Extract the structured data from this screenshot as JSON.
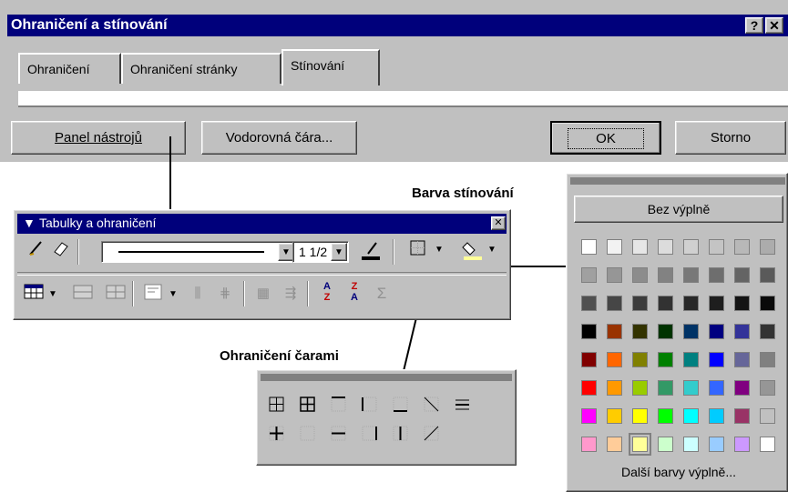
{
  "dialog": {
    "title": "Ohraničení a stínování",
    "title_buttons": [
      "?",
      "✕"
    ],
    "tabs": [
      {
        "label": "Ohraničení",
        "active": false
      },
      {
        "label": "Ohraničení stránky",
        "active": false
      },
      {
        "label": "Stínování",
        "active": true
      }
    ],
    "buttons": {
      "toolbar": "Panel nástrojů",
      "horizontal_line": "Vodorovná čára...",
      "ok": "OK",
      "cancel": "Storno"
    }
  },
  "toolbar": {
    "title": "Tabulky a ohraničení",
    "close": "✕",
    "line_weight": "1 1/2",
    "row1_icons": [
      "pencil-icon",
      "eraser-icon",
      "line-style-dropdown",
      "line-weight-dropdown",
      "border-color-icon",
      "outside-border-icon",
      "shading-color-icon"
    ],
    "row2_icons": [
      "insert-table-icon",
      "merge-cells-icon",
      "split-cells-icon",
      "align-icon",
      "distribute-rows-icon",
      "distribute-columns-icon",
      "autoformat-icon",
      "text-direction-icon",
      "sort-ascending-icon",
      "sort-descending-icon",
      "autosum-icon"
    ]
  },
  "callouts": {
    "shading_color": "Barva stínování",
    "border_lines": "Ohraničení čarami"
  },
  "shading_palette": {
    "no_fill": "Bez výplně",
    "more_colors": "Další barvy výplně...",
    "colors": [
      [
        "#ffffff",
        "#f2f2f2",
        "#e6e6e6",
        "#dcdcdc",
        "#d0d0d0",
        "#c4c4c4",
        "#b8b8b8",
        "#acacac"
      ],
      [
        "#a0a0a0",
        "#969696",
        "#8c8c8c",
        "#828282",
        "#787878",
        "#6e6e6e",
        "#646464",
        "#5a5a5a"
      ],
      [
        "#505050",
        "#464646",
        "#3c3c3c",
        "#323232",
        "#282828",
        "#1e1e1e",
        "#141414",
        "#0a0a0a"
      ],
      [
        "#000000",
        "#993300",
        "#333300",
        "#003300",
        "#003366",
        "#000080",
        "#333399",
        "#333333"
      ],
      [
        "#800000",
        "#ff6600",
        "#808000",
        "#008000",
        "#008080",
        "#0000ff",
        "#666699",
        "#808080"
      ],
      [
        "#ff0000",
        "#ff9900",
        "#99cc00",
        "#339966",
        "#33cccc",
        "#3366ff",
        "#800080",
        "#969696"
      ],
      [
        "#ff00ff",
        "#ffcc00",
        "#ffff00",
        "#00ff00",
        "#00ffff",
        "#00ccff",
        "#993366",
        "#c0c0c0"
      ],
      [
        "#ff99cc",
        "#ffcc99",
        "#ffff99",
        "#ccffcc",
        "#ccffff",
        "#99ccff",
        "#cc99ff",
        "#ffffff"
      ]
    ],
    "selected": "#ffff99"
  },
  "border_palette": {
    "icons": [
      "inside-border-icon",
      "all-borders-icon",
      "top-border-icon",
      "left-border-icon",
      "bottom-border-icon",
      "diagonal-down-icon",
      "horizontal-line-icon",
      "inside-horizontal-icon",
      "inside-vertical-icon",
      "outside-bottom-icon",
      "right-border-icon",
      "no-border-icon",
      "diagonal-up-icon"
    ]
  }
}
